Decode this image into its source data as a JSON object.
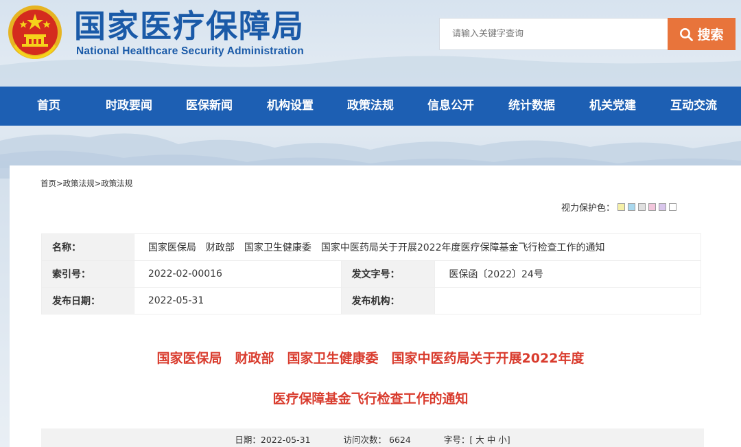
{
  "header": {
    "title": "国家医疗保障局",
    "subtitle": "National Healthcare Security Administration",
    "search_placeholder": "请输入关键字查询",
    "search_button": "搜索"
  },
  "nav": {
    "items": [
      "首页",
      "时政要闻",
      "医保新闻",
      "机构设置",
      "政策法规",
      "信息公开",
      "统计数据",
      "机关党建",
      "互动交流"
    ]
  },
  "breadcrumb": [
    "首页",
    "政策法规",
    "政策法规"
  ],
  "eye_care": {
    "label": "视力保护色：",
    "colors": [
      "#f5f0a8",
      "#a9d8ee",
      "#e0e0e0",
      "#f2c6dc",
      "#d9c6ec",
      "#ffffff"
    ]
  },
  "meta": {
    "name_label": "名称：",
    "name_value": "国家医保局　财政部　国家卫生健康委　国家中医药局关于开展2022年度医疗保障基金飞行检查工作的通知",
    "index_label": "索引号：",
    "index_value": "2022-02-00016",
    "doc_no_label": "发文字号：",
    "doc_no_value": "医保函〔2022〕24号",
    "date_label": "发布日期：",
    "date_value": "2022-05-31",
    "org_label": "发布机构：",
    "org_value": ""
  },
  "article": {
    "title_line1": "国家医保局　财政部　国家卫生健康委　国家中医药局关于开展2022年度",
    "title_line2": "医疗保障基金飞行检查工作的通知",
    "date_text": "日期：2022-05-31",
    "visits_text": "访问次数： 6624",
    "font_size_label": "字号：[",
    "font_large": "大",
    "font_medium": "中",
    "font_small": "小",
    "font_size_end": "]"
  },
  "colors": {
    "brand_blue": "#1d5fb3",
    "title_red": "#d93c2e",
    "search_orange": "#e8743b"
  }
}
